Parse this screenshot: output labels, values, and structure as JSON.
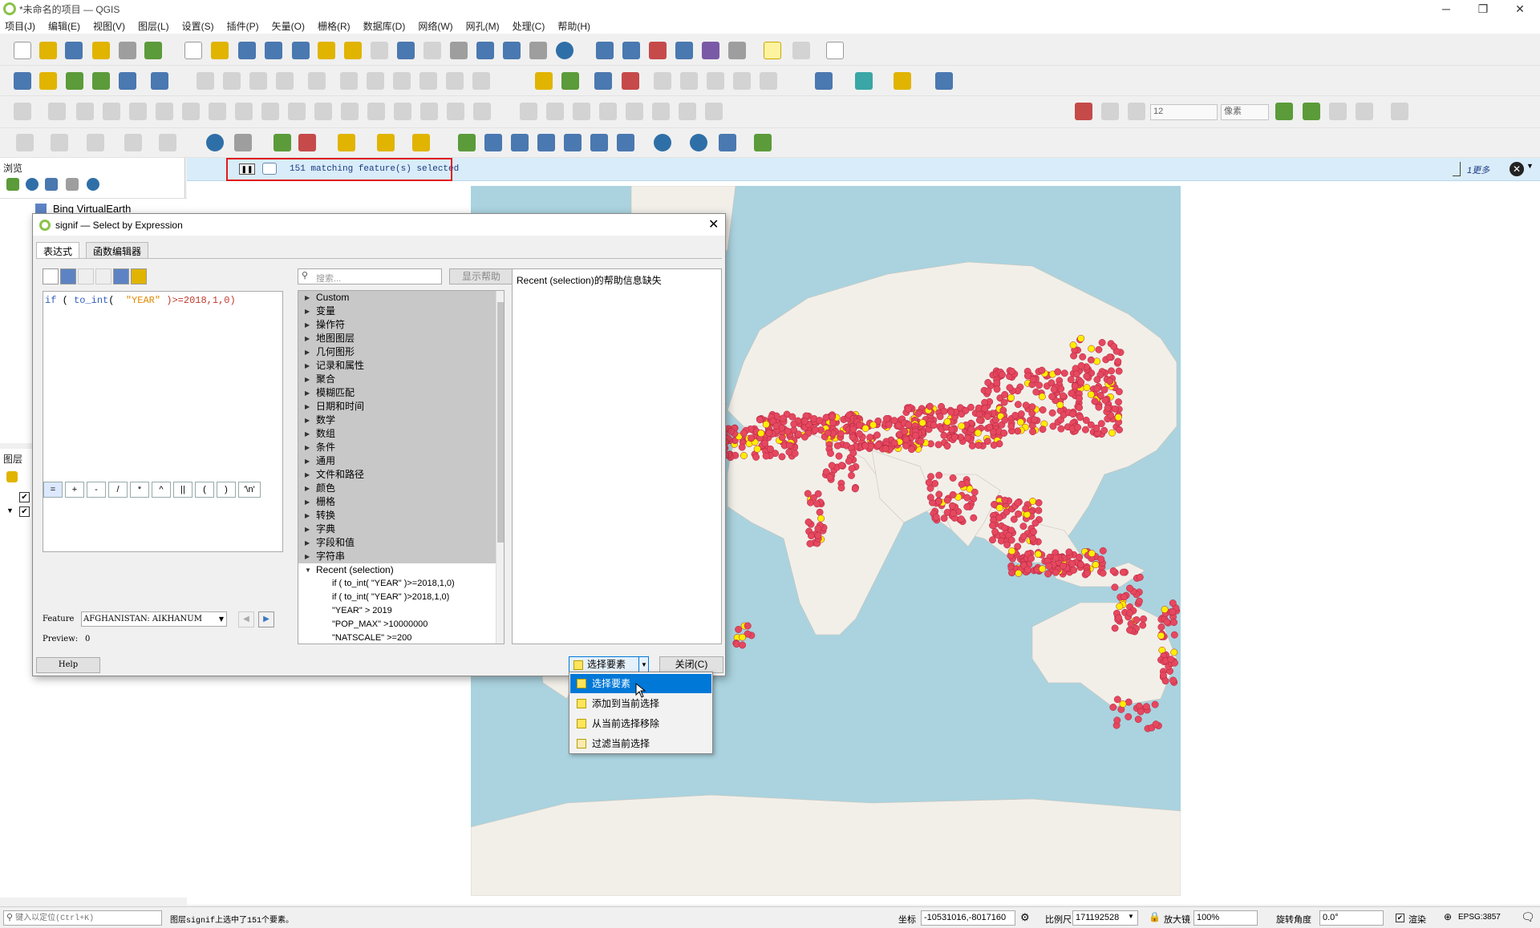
{
  "window": {
    "title": "*未命名的项目 — QGIS",
    "minimize": "─",
    "restore": "❐",
    "close": "✕"
  },
  "menu": [
    "项目(J)",
    "编辑(E)",
    "视图(V)",
    "图层(L)",
    "设置(S)",
    "插件(P)",
    "矢量(O)",
    "栅格(R)",
    "数据库(D)",
    "网络(W)",
    "网孔(M)",
    "处理(C)",
    "帮助(H)"
  ],
  "snapping": {
    "tolerance_value": "12",
    "units": "像素"
  },
  "browser": {
    "title": "浏览",
    "item": "Bing VirtualEarth"
  },
  "layers": {
    "title": "图层"
  },
  "message_bar": {
    "text": "151 matching feature(s) selected",
    "more": "1更多"
  },
  "dialog": {
    "title": "signif — Select by Expression",
    "tabs": [
      "表达式",
      "函数编辑器"
    ],
    "expression": {
      "p1": "if",
      "p2": " ( ",
      "p3": "to_int",
      "p4": "(  ",
      "p5": "\"YEAR\"",
      "p6": " )>=2018,1,0)"
    },
    "operators": [
      "=",
      "+",
      "-",
      "/",
      "*",
      "^",
      "||",
      "(",
      ")",
      "'\\n'"
    ],
    "feature_label": "Feature",
    "feature_value": "AFGHANISTAN:  AIKHANUM",
    "preview_label": "Preview:",
    "preview_value": "0",
    "search_placeholder": "搜索...",
    "show_help": "显示帮助",
    "tree_groups": [
      "Custom",
      "变量",
      "操作符",
      "地图图层",
      "几何图形",
      "记录和属性",
      "聚合",
      "模糊匹配",
      "日期和时间",
      "数学",
      "数组",
      "条件",
      "通用",
      "文件和路径",
      "颜色",
      "栅格",
      "转换",
      "字典",
      "字段和值",
      "字符串"
    ],
    "recent_group": "Recent (selection)",
    "recent_items": [
      "if ( to_int(  \"YEAR\" )>=2018,1,0)",
      "if ( to_int(  \"YEAR\" )>2018,1,0)",
      "\"YEAR\" > 2019",
      "\"POP_MAX\" >10000000",
      "\"NATSCALE\" >=200"
    ],
    "help_text": "Recent (selection)的帮助信息缺失",
    "help_button": "Help",
    "select_button": "选择要素",
    "close_button": "关闭(C)"
  },
  "select_menu": [
    "选择要素",
    "添加到当前选择",
    "从当前选择移除",
    "过滤当前选择"
  ],
  "status": {
    "locator_placeholder": "键入以定位(Ctrl+K)",
    "message": "图层signif上选中了151个要素。",
    "coord_label": "坐标",
    "coord_value": "-10531016,-8017160",
    "scale_label": "比例尺",
    "scale_value": "171192528",
    "magnifier_label": "放大镜",
    "magnifier_value": "100%",
    "rotation_label": "旋转角度",
    "rotation_value": "0.0°",
    "render_label": "渲染",
    "crs": "EPSG:3857"
  }
}
